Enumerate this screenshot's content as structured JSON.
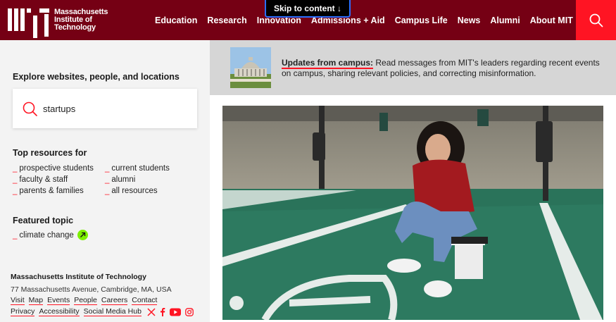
{
  "header": {
    "logo_text_line1": "Massachusetts",
    "logo_text_line2": "Institute of",
    "logo_text_line3": "Technology",
    "nav": [
      "Education",
      "Research",
      "Innovation",
      "Admissions + Aid",
      "Campus Life",
      "News",
      "Alumni",
      "About MIT"
    ],
    "skip_link": "Skip to content ↓",
    "search_icon": "search-icon"
  },
  "explore": {
    "title": "Explore websites, people, and locations",
    "search_value": "startups"
  },
  "top_resources": {
    "title": "Top resources for",
    "items": [
      "prospective students",
      "current students",
      "faculty & staff",
      "alumni",
      "parents & families",
      "all resources"
    ]
  },
  "featured": {
    "title": "Featured topic",
    "item": "climate change"
  },
  "footer": {
    "org": "Massachusetts Institute of Technology",
    "address": "77 Massachusetts Avenue, Cambridge, MA, USA",
    "links_row1": [
      "Visit",
      "Map",
      "Events",
      "People",
      "Careers",
      "Contact"
    ],
    "links_row2": [
      "Privacy",
      "Accessibility",
      "Social Media Hub"
    ],
    "social_icons": [
      "x-icon",
      "facebook-icon",
      "youtube-icon",
      "instagram-icon"
    ]
  },
  "updates": {
    "lead": "Updates from campus:",
    "body": " Read messages from MIT's leaders regarding recent events on campus, sharing relevant policies, and correcting misinformation."
  },
  "colors": {
    "header_bg": "#750014",
    "accent_red": "#ff1423",
    "badge_green": "#7cf000",
    "left_bg": "#f3f3f3",
    "updates_bg": "#d6d6d6"
  }
}
